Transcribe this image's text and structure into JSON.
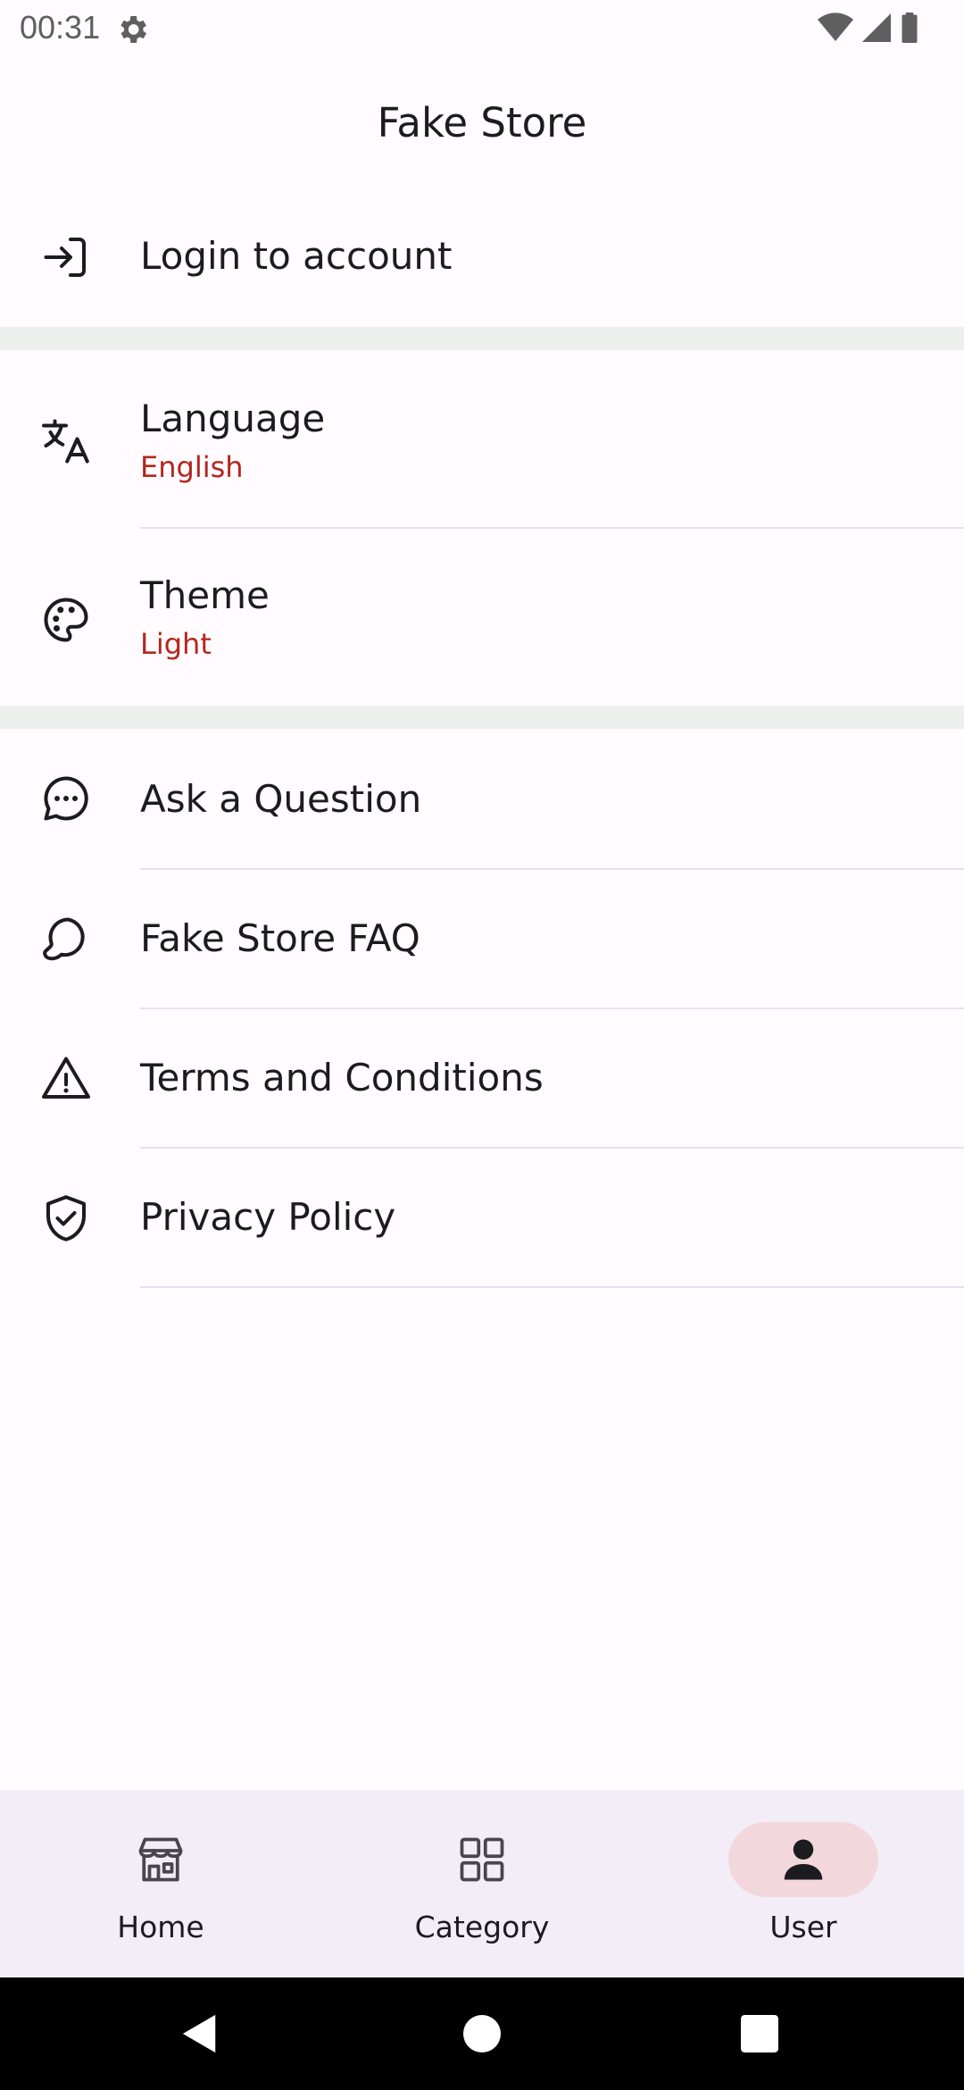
{
  "status_bar": {
    "time": "00:31"
  },
  "app_bar": {
    "title": "Fake Store"
  },
  "account": {
    "login_label": "Login to account"
  },
  "preferences": {
    "language_label": "Language",
    "language_value": "English",
    "theme_label": "Theme",
    "theme_value": "Light"
  },
  "support": {
    "items": [
      {
        "label": "Ask a Question",
        "icon": "chat-dots-icon"
      },
      {
        "label": "Fake Store FAQ",
        "icon": "chat-bubble-icon"
      },
      {
        "label": "Terms and Conditions",
        "icon": "warning-icon"
      },
      {
        "label": "Privacy Policy",
        "icon": "shield-check-icon"
      }
    ]
  },
  "bottom_nav": {
    "items": [
      {
        "label": "Home",
        "icon": "store-icon",
        "active": false
      },
      {
        "label": "Category",
        "icon": "grid-icon",
        "active": false
      },
      {
        "label": "User",
        "icon": "person-icon",
        "active": true
      }
    ]
  },
  "colors": {
    "accent_text": "#b3261e",
    "active_pill": "#f2d8dc",
    "nav_background": "#f3edf7",
    "section_gap": "#ecefec"
  }
}
